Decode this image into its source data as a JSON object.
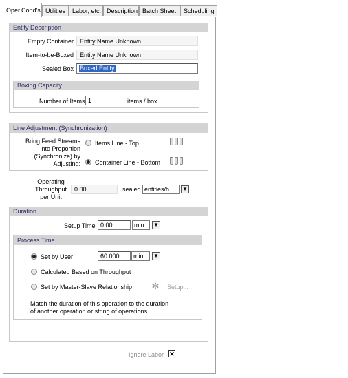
{
  "tabs": [
    {
      "label": "Oper.Cond's"
    },
    {
      "label": "Utilities"
    },
    {
      "label": "Labor, etc."
    },
    {
      "label": "Description"
    },
    {
      "label": "Batch Sheet"
    },
    {
      "label": "Scheduling"
    }
  ],
  "entity_description": {
    "title": "Entity Description",
    "empty_container_label": "Empty Container",
    "empty_container_value": "Entity Name Unknown",
    "item_to_be_boxed_label": "Item-to-be-Boxed",
    "item_to_be_boxed_value": "Entity Name Unknown",
    "sealed_box_label": "Sealed Box",
    "sealed_box_value": "Boxed Entity"
  },
  "boxing_capacity": {
    "title": "Boxing Capacity",
    "number_label": "Number of Items",
    "number_value": "1",
    "unit": "items / box"
  },
  "line_adjustment": {
    "title": "Line Adjustment (Synchronization)",
    "description": "Bring Feed Streams into Proportion (Synchronize) by Adjusting:",
    "option_items": "Items Line - Top",
    "option_container": "Container Line - Bottom",
    "selected": "container"
  },
  "throughput": {
    "label": "Operating Throughput per Unit",
    "value": "0.00",
    "sealed_label": "sealed",
    "unit": "entities/h"
  },
  "duration": {
    "title": "Duration",
    "setup_label": "Setup Time",
    "setup_value": "0.00",
    "setup_unit": "min"
  },
  "process_time": {
    "title": "Process Time",
    "set_by_user": "Set by User",
    "user_value": "60.000",
    "user_unit": "min",
    "calculated": "Calculated Based on Throughput",
    "master_slave": "Set by Master-Slave Relationship",
    "setup_button": "Setup...",
    "match_text": "Match the duration of this operation to the duration of another operation or string of operations.",
    "selected": "set_by_user"
  },
  "ignore": {
    "label": "Ignore Labor",
    "checked": true
  }
}
